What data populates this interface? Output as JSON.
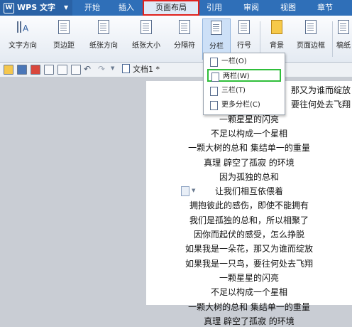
{
  "app": {
    "name": "WPS 文字",
    "logo": "W"
  },
  "menu": [
    {
      "label": "开始"
    },
    {
      "label": "插入"
    },
    {
      "label": "页面布局"
    },
    {
      "label": "引用"
    },
    {
      "label": "审阅"
    },
    {
      "label": "视图"
    },
    {
      "label": "章节"
    }
  ],
  "ribbon": {
    "text_direction": "文字方向",
    "margins": "页边距",
    "orientation": "纸张方向",
    "paper_size": "纸张大小",
    "separator": "分隔符",
    "columns": "分栏",
    "line_numbers": "行号",
    "background": "背景",
    "page_border": "页面边框",
    "paper_label": "稿纸"
  },
  "tab": {
    "name": "文档1 *"
  },
  "columns_menu": {
    "one": "一栏(O)",
    "two": "两栏(W)",
    "three": "三栏(T)",
    "more": "更多分栏(C)"
  },
  "content": [
    "，那又为谁而绽放",
    "，要往何处去飞翔",
    "一颗星星的闪亮",
    "不足以构成一个星相",
    "一颗大树的总和  集结单一的重量",
    "真理  辟空了孤寂  的环境",
    "因为孤独的总和",
    "让我们相互依偎着",
    "拥抱彼此的感伤，即使不能拥有",
    "我们是孤独的总和，所以相聚了",
    "因你而起伏的感受，怎么挣脱",
    "如果我是一朵花，那又为谁而绽放",
    "如果我是一只鸟，要往何处去飞翔",
    "一颗星星的闪亮",
    "不足以构成一个星相",
    "一颗大树的总和  集结单一的重量",
    "真理  辟空了孤寂  的环境"
  ],
  "colors": {
    "title_bar": "#2f6fb8",
    "highlight_red": "#e0201c",
    "highlight_green": "#2fbe3a"
  }
}
